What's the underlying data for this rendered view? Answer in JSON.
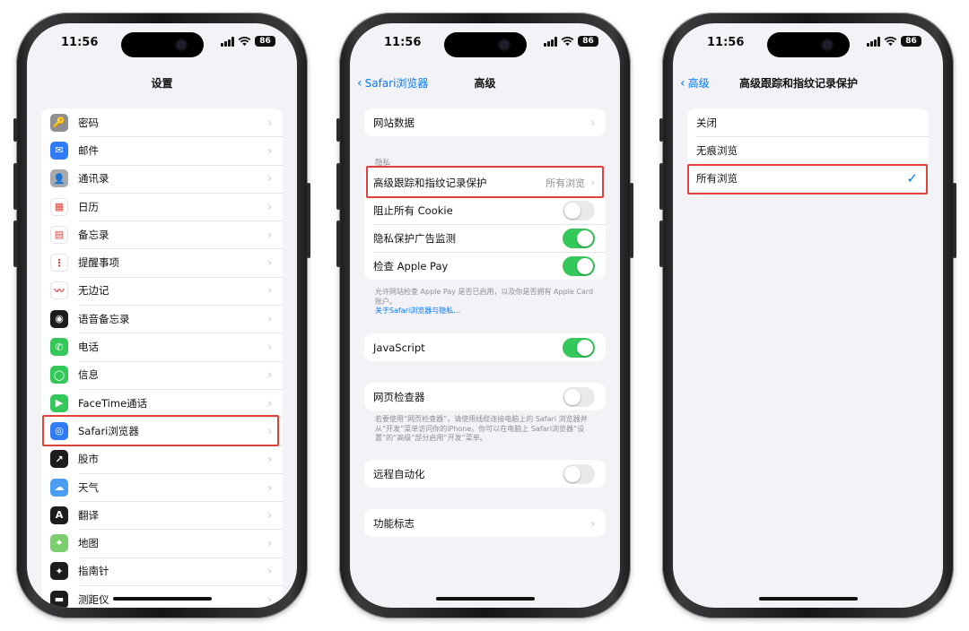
{
  "colors": {
    "accent": "#007aff",
    "toggle_on": "#34c759",
    "highlight": "#e0413a"
  },
  "status": {
    "time": "11:56",
    "battery": "86"
  },
  "screen1": {
    "title": "设置",
    "items": [
      {
        "label": "密码",
        "icon": "key-icon",
        "color": "#8e8e93",
        "glyph": "🔑"
      },
      {
        "label": "邮件",
        "icon": "mail-icon",
        "color": "#2f7cf6",
        "glyph": "✉"
      },
      {
        "label": "通讯录",
        "icon": "contacts-icon",
        "color": "#a8a8ad",
        "glyph": "👤"
      },
      {
        "label": "日历",
        "icon": "calendar-icon",
        "color": "#ffffff",
        "glyph": "▦"
      },
      {
        "label": "备忘录",
        "icon": "notes-icon",
        "color": "#ffffff",
        "glyph": "▤"
      },
      {
        "label": "提醒事项",
        "icon": "reminders-icon",
        "color": "#ffffff",
        "glyph": "⋮"
      },
      {
        "label": "无边记",
        "icon": "freeform-icon",
        "color": "#ffffff",
        "glyph": "〰"
      },
      {
        "label": "语音备忘录",
        "icon": "voice-memos-icon",
        "color": "#1c1c1e",
        "glyph": "◉"
      },
      {
        "label": "电话",
        "icon": "phone-icon",
        "color": "#34c759",
        "glyph": "✆"
      },
      {
        "label": "信息",
        "icon": "messages-icon",
        "color": "#34c759",
        "glyph": "◯"
      },
      {
        "label": "FaceTime通话",
        "icon": "facetime-icon",
        "color": "#34c759",
        "glyph": "▶"
      },
      {
        "label": "Safari浏览器",
        "icon": "safari-icon",
        "color": "#2f7cf6",
        "glyph": "◎"
      },
      {
        "label": "股市",
        "icon": "stocks-icon",
        "color": "#1c1c1e",
        "glyph": "↗"
      },
      {
        "label": "天气",
        "icon": "weather-icon",
        "color": "#4a9df0",
        "glyph": "☁"
      },
      {
        "label": "翻译",
        "icon": "translate-icon",
        "color": "#1c1c1e",
        "glyph": "A"
      },
      {
        "label": "地图",
        "icon": "maps-icon",
        "color": "#7ccf6f",
        "glyph": "⌖"
      },
      {
        "label": "指南针",
        "icon": "compass-icon",
        "color": "#1c1c1e",
        "glyph": "✦"
      },
      {
        "label": "测距仪",
        "icon": "measure-icon",
        "color": "#1c1c1e",
        "glyph": "▬"
      }
    ]
  },
  "screen2": {
    "back": "Safari浏览器",
    "title": "高级",
    "website_data": "网站数据",
    "privacy_header": "隐私",
    "tracking": {
      "label": "高级跟踪和指纹记录保护",
      "value": "所有浏览"
    },
    "block_cookies": "阻止所有 Cookie",
    "privacy_ad": "隐私保护广告监测",
    "apple_pay": "检查 Apple Pay",
    "apple_pay_note": "允许网站检查 Apple Pay 是否已启用，以及你是否拥有 Apple Card 账户。",
    "apple_pay_link": "关于Safari浏览器与隐私…",
    "javascript": "JavaScript",
    "web_inspector": "网页检查器",
    "web_inspector_note": "若要使用“网页检查器”，请使用线缆连接电脑上的 Safari 浏览器并从“开发”菜单访问你的iPhone。你可以在电脑上 Safari浏览器“设置”的“高级”部分启用“开发”菜单。",
    "remote_automation": "远程自动化",
    "feature_flags": "功能标志"
  },
  "screen3": {
    "back": "高级",
    "title": "高级跟踪和指纹记录保护",
    "options": [
      "关闭",
      "无痕浏览",
      "所有浏览"
    ],
    "selected_index": 2
  }
}
